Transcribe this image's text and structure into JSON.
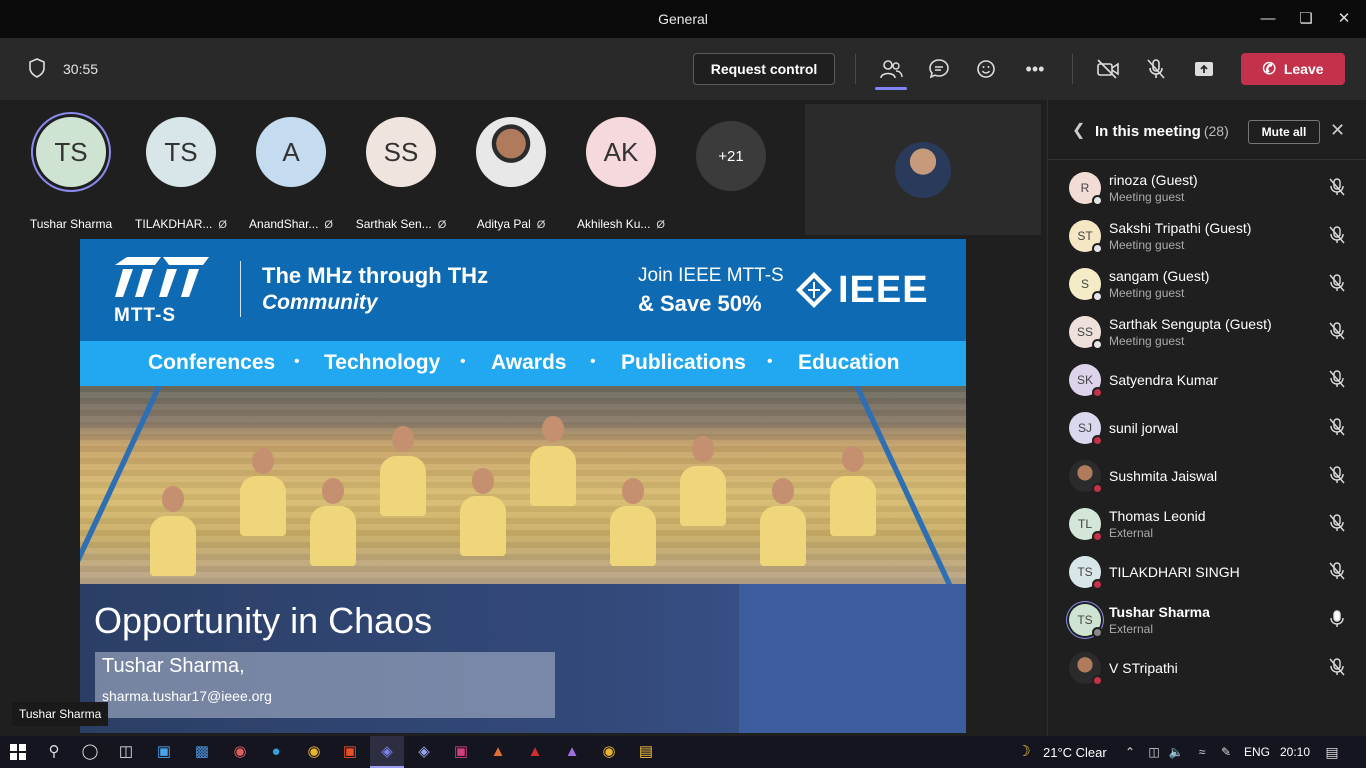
{
  "window": {
    "title": "General"
  },
  "toolbar": {
    "timer": "30:55",
    "request_control": "Request control",
    "leave": "Leave",
    "icons": [
      "shield-icon",
      "people-icon",
      "chat-icon",
      "reactions-icon",
      "more-icon",
      "camera-off-icon",
      "mic-off-icon",
      "share-icon",
      "phone-icon"
    ]
  },
  "participants_strip": [
    {
      "initials": "TS",
      "name": "Tushar Sharma",
      "muted": false,
      "speaking": true,
      "color": "#cfe3d3"
    },
    {
      "initials": "TS",
      "name": "TILAKDHAR...",
      "muted": true,
      "color": "#d8e6ea"
    },
    {
      "initials": "A",
      "name": "AnandShar...",
      "muted": true,
      "color": "#c5dcf0"
    },
    {
      "initials": "SS",
      "name": "Sarthak Sen...",
      "muted": true,
      "color": "#f0e4de"
    },
    {
      "initials": "",
      "name": "Aditya Pal",
      "muted": true,
      "photo": true
    },
    {
      "initials": "AK",
      "name": "Akhilesh Ku...",
      "muted": true,
      "color": "#f5d9dd"
    }
  ],
  "more_participants": "+21",
  "slide": {
    "tagline_line1": "The  MHz through THz",
    "tagline_line2": "Community",
    "logo_text": "MTT-S",
    "join_line1": "Join IEEE MTT-S",
    "join_line2": "& Save 50%",
    "ieee": "IEEE",
    "nav": [
      "Conferences",
      "Technology",
      "Awards",
      "Publications",
      "Education"
    ],
    "title": "Opportunity in Chaos",
    "author": "Tushar Sharma,",
    "email": "sharma.tushar17@ieee.org"
  },
  "presenter_tag": "Tushar Sharma",
  "panel": {
    "title": "In this meeting",
    "count": "(28)",
    "mute_all": "Mute all",
    "people": [
      {
        "initials": "R",
        "name": "rinoza (Guest)",
        "sub": "Meeting guest",
        "color": "#f3dcd6",
        "status": "#e6e6e6",
        "mic": "off"
      },
      {
        "initials": "ST",
        "name": "Sakshi Tripathi (Guest)",
        "sub": "Meeting guest",
        "color": "#f6e7c4",
        "status": "#e6e6e6",
        "mic": "off"
      },
      {
        "initials": "S",
        "name": "sangam (Guest)",
        "sub": "Meeting guest",
        "color": "#f4ecc6",
        "status": "#e6e6e6",
        "mic": "off"
      },
      {
        "initials": "SS",
        "name": "Sarthak Sengupta (Guest)",
        "sub": "Meeting guest",
        "color": "#eee1dc",
        "status": "#e6e6e6",
        "mic": "off"
      },
      {
        "initials": "SK",
        "name": "Satyendra Kumar",
        "sub": "",
        "color": "#ddd4ec",
        "status": "#c4314b",
        "mic": "off"
      },
      {
        "initials": "SJ",
        "name": "sunil jorwal",
        "sub": "",
        "color": "#d9d8ee",
        "status": "#c4314b",
        "mic": "off"
      },
      {
        "initials": "",
        "name": "Sushmita Jaiswal",
        "sub": "",
        "photo": true,
        "status": "#c4314b",
        "mic": "off"
      },
      {
        "initials": "TL",
        "name": "Thomas Leonid",
        "sub": "External",
        "color": "#d3e6d8",
        "status": "#c4314b",
        "mic": "off"
      },
      {
        "initials": "TS",
        "name": "TILAKDHARI SINGH",
        "sub": "",
        "color": "#d8e6ea",
        "status": "#c4314b",
        "mic": "off"
      },
      {
        "initials": "TS",
        "name": "Tushar Sharma",
        "sub": "External",
        "color": "#cfe3d3",
        "status": "#888888",
        "mic": "on",
        "bold": true
      },
      {
        "initials": "",
        "name": "V STripathi",
        "sub": "",
        "photo": true,
        "status": "#c4314b",
        "mic": "off"
      }
    ]
  },
  "taskbar": {
    "weather": "21°C  Clear",
    "lang": "ENG",
    "time": "20:10"
  }
}
